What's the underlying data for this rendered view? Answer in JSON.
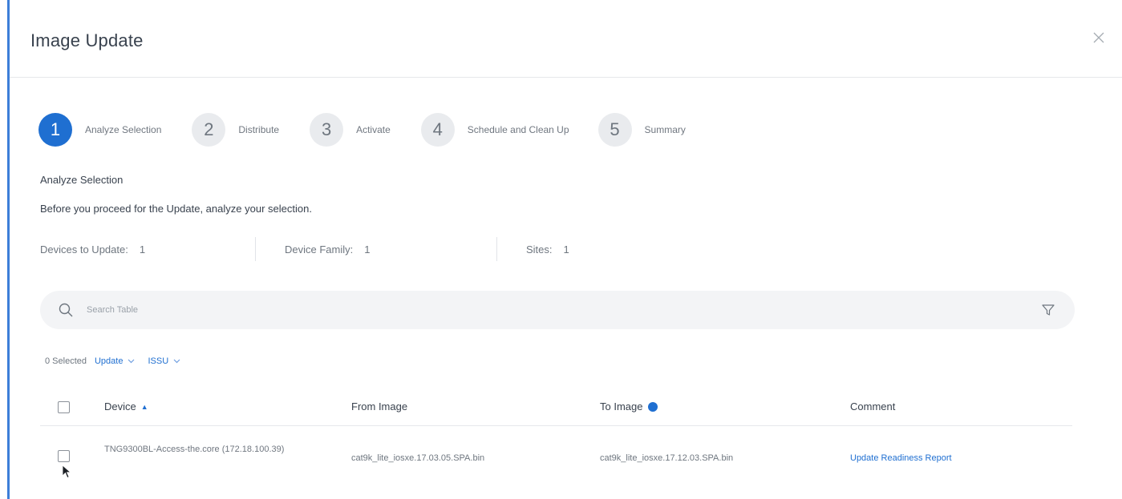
{
  "dialog": {
    "title": "Image Update",
    "close_icon": "close-icon"
  },
  "stepper": {
    "steps": [
      {
        "number": "1",
        "label": "Analyze Selection",
        "active": true
      },
      {
        "number": "2",
        "label": "Distribute",
        "active": false
      },
      {
        "number": "3",
        "label": "Activate",
        "active": false
      },
      {
        "number": "4",
        "label": "Schedule and Clean Up",
        "active": false
      },
      {
        "number": "5",
        "label": "Summary",
        "active": false
      }
    ]
  },
  "section": {
    "title": "Analyze Selection",
    "description": "Before you proceed for the Update, analyze your selection."
  },
  "counters": [
    {
      "label": "Devices to Update:",
      "value": "1"
    },
    {
      "label": "Device Family:",
      "value": "1"
    },
    {
      "label": "Sites:",
      "value": "1"
    }
  ],
  "search": {
    "placeholder": "Search Table",
    "icon": "search-icon",
    "filter_icon": "filter-icon"
  },
  "toolbar": {
    "selected": "0 Selected",
    "update_label": "Update",
    "issu_label": "ISSU"
  },
  "table": {
    "headers": {
      "device": "Device",
      "from_image": "From Image",
      "to_image": "To Image",
      "comment": "Comment"
    },
    "rows": [
      {
        "device": "TNG9300BL-Access-the.core (172.18.100.39)",
        "from_image": "cat9k_lite_iosxe.17.03.05.SPA.bin",
        "to_image": "cat9k_lite_iosxe.17.12.03.SPA.bin",
        "comment": "Update Readiness Report"
      }
    ]
  },
  "colors": {
    "accent": "#1f6fd1",
    "left_bar": "#3d7ed8"
  }
}
